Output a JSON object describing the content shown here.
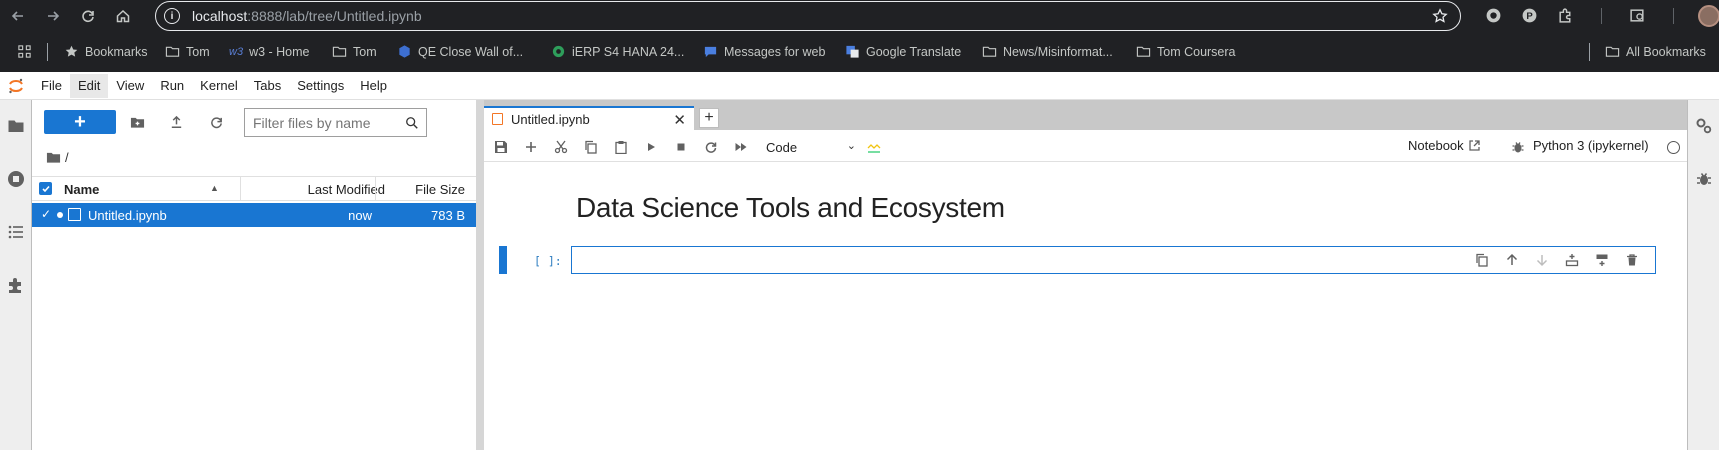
{
  "browser": {
    "url_host": "localhost",
    "url_path": ":8888/lab/tree/Untitled.ipynb",
    "bookmarks": [
      {
        "label": "Bookmarks",
        "icon": "star-icon"
      },
      {
        "label": "Tom",
        "icon": "folder-icon"
      },
      {
        "label": "w3 - Home",
        "icon": "w3-icon"
      },
      {
        "label": "Tom",
        "icon": "folder-icon"
      },
      {
        "label": "QE Close Wall of...",
        "icon": "site-icon"
      },
      {
        "label": "iERP S4 HANA 24...",
        "icon": "site-icon"
      },
      {
        "label": "Messages for web",
        "icon": "messages-icon"
      },
      {
        "label": "Google Translate",
        "icon": "translate-icon"
      },
      {
        "label": "News/Misinformat...",
        "icon": "folder-icon"
      },
      {
        "label": "Tom Coursera",
        "icon": "folder-icon"
      }
    ],
    "all_bookmarks": "All Bookmarks"
  },
  "menubar": {
    "items": [
      "File",
      "Edit",
      "View",
      "Run",
      "Kernel",
      "Tabs",
      "Settings",
      "Help"
    ],
    "active": "Edit"
  },
  "filebrowser": {
    "new_label": "+",
    "filter_placeholder": "Filter files by name",
    "breadcrumb": "/",
    "columns": {
      "name": "Name",
      "modified": "Last Modified",
      "size": "File Size"
    },
    "files": [
      {
        "name": "Untitled.ipynb",
        "modified": "now",
        "size": "783 B",
        "selected": true,
        "running": true
      }
    ]
  },
  "notebook": {
    "tab_label": "Untitled.ipynb",
    "tab_close": "✕",
    "tab_add": "+",
    "cell_type": "Code",
    "notebook_link": "Notebook",
    "kernel_name": "Python 3 (ipykernel)",
    "heading": "Data Science Tools and Ecosystem",
    "cell_prompt": "[ ]:"
  },
  "colors": {
    "accent": "#1976d2",
    "browser_bg": "#202124",
    "jupyter_orange": "#f37626"
  }
}
